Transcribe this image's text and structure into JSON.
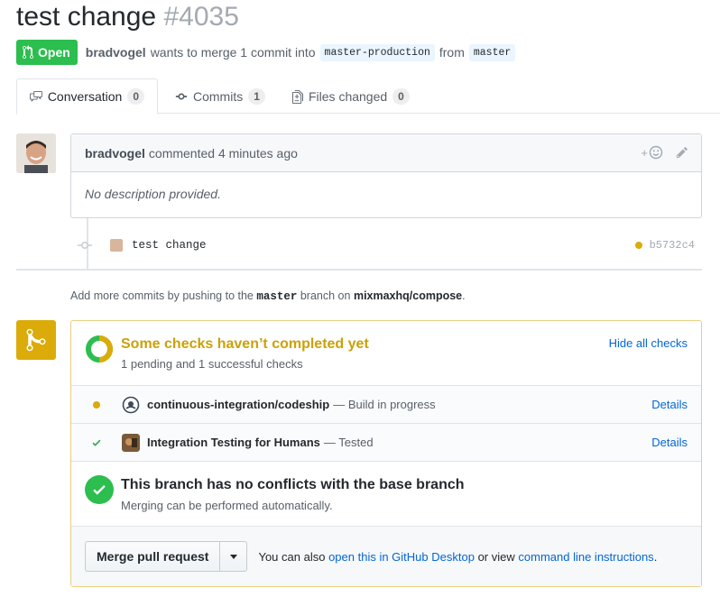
{
  "header": {
    "title": "test change",
    "number": "#4035"
  },
  "meta": {
    "state": "Open",
    "author": "bradvogel",
    "wants_text": "wants to merge 1 commit into",
    "base_branch": "master-production",
    "from_text": "from",
    "head_branch": "master"
  },
  "tabs": [
    {
      "label": "Conversation",
      "count": "0"
    },
    {
      "label": "Commits",
      "count": "1"
    },
    {
      "label": "Files changed",
      "count": "0"
    }
  ],
  "comment": {
    "author": "bradvogel",
    "action": "commented 4 minutes ago",
    "add_reaction": "+",
    "body": "No description provided."
  },
  "commit": {
    "message": "test change",
    "sha": "b5732c4"
  },
  "push_hint": {
    "prefix": "Add more commits by pushing to the",
    "branch": "master",
    "middle": "branch on",
    "repo": "mixmaxhq/compose",
    "suffix": "."
  },
  "checks": {
    "title": "Some checks haven’t completed yet",
    "subtitle": "1 pending and 1 successful checks",
    "hide_label": "Hide all checks",
    "items": [
      {
        "name": "continuous-integration/codeship",
        "desc": "— Build in progress",
        "details": "Details",
        "status": "pending"
      },
      {
        "name": "Integration Testing for Humans",
        "desc": "— Tested",
        "details": "Details",
        "status": "success"
      }
    ]
  },
  "conflicts": {
    "title": "This branch has no conflicts with the base branch",
    "subtitle": "Merging can be performed automatically."
  },
  "merge": {
    "button": "Merge pull request",
    "also_prefix": "You can also",
    "desktop_link": "open this in GitHub Desktop",
    "or_view": "or view",
    "cli_link": "command line instructions",
    "suffix": "."
  },
  "colors": {
    "open_green": "#2cbe4e",
    "pending_yellow": "#dbab09",
    "link_blue": "#0366d6"
  }
}
